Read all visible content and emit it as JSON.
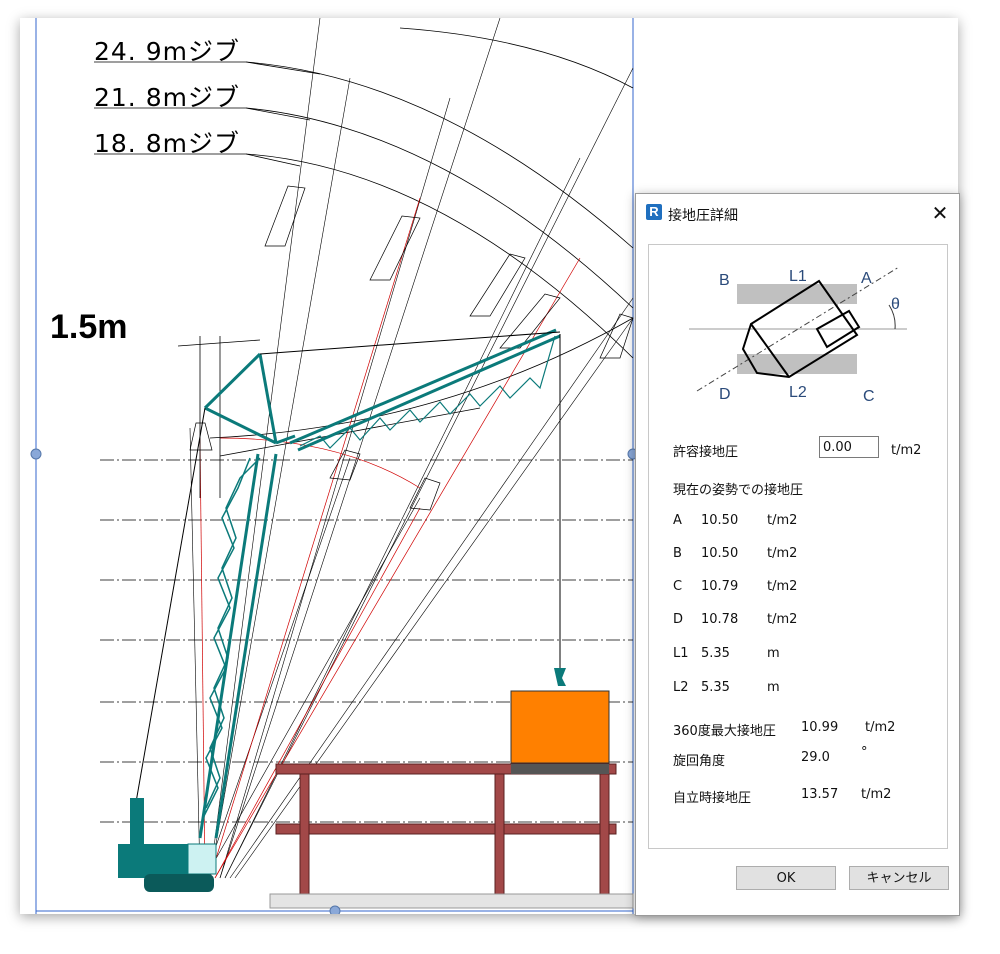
{
  "drawing": {
    "jib_labels": [
      "24. 9mジブ",
      "21. 8mジブ",
      "18. 8mジブ"
    ],
    "dimension_label": "1.5m",
    "colors": {
      "crane": "#0b7a7a",
      "load": "#ff8000",
      "structure": "#a24848",
      "cab": "#cdf2f2"
    }
  },
  "dialog": {
    "title": "接地圧詳細",
    "app_icon": "R",
    "close_symbol": "✕",
    "diagram": {
      "labels": [
        "B",
        "L1",
        "A",
        "θ",
        "D",
        "L2",
        "C"
      ]
    },
    "allowable": {
      "label": "許容接地圧",
      "value": "0.00",
      "unit": "t/m2"
    },
    "current_heading": "現在の姿勢での接地圧",
    "pressures": [
      {
        "name": "A",
        "value": "10.50",
        "unit": "t/m2"
      },
      {
        "name": "B",
        "value": "10.50",
        "unit": "t/m2"
      },
      {
        "name": "C",
        "value": "10.79",
        "unit": "t/m2"
      },
      {
        "name": "D",
        "value": "10.78",
        "unit": "t/m2"
      },
      {
        "name": "L1",
        "value": "5.35",
        "unit": "m"
      },
      {
        "name": "L2",
        "value": "5.35",
        "unit": "m"
      }
    ],
    "max_360": {
      "label": "360度最大接地圧",
      "value": "10.99",
      "unit": "t/m2"
    },
    "swing_angle": {
      "label": "旋回角度",
      "value": "29.0",
      "unit": "°"
    },
    "standalone": {
      "label": "自立時接地圧",
      "value": "13.57",
      "unit": "t/m2"
    },
    "ok_label": "OK",
    "cancel_label": "キャンセル"
  }
}
